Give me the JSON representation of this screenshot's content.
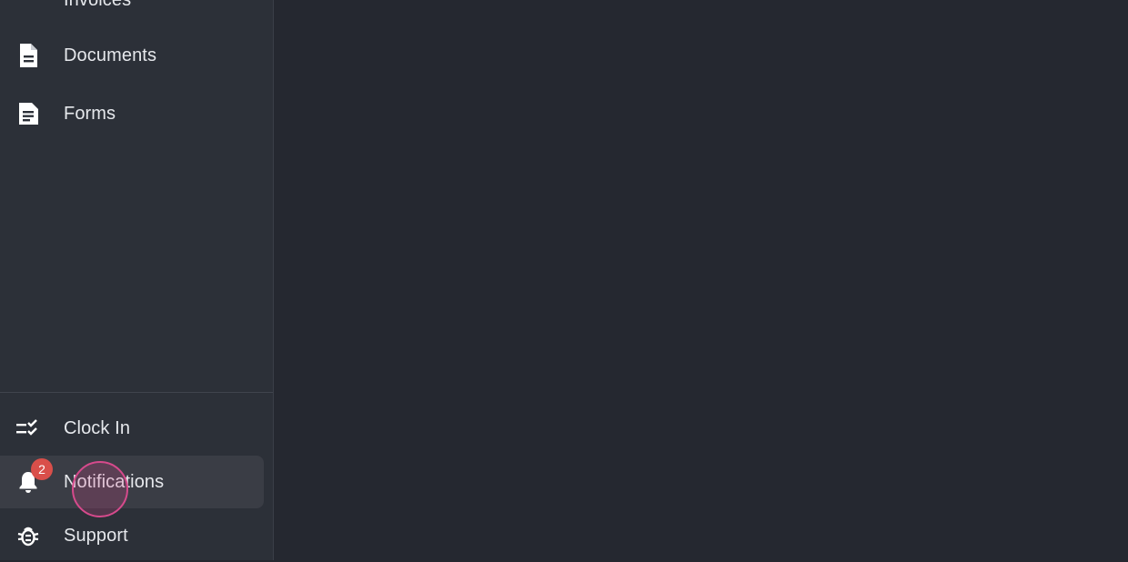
{
  "sidebar": {
    "top_items": [
      {
        "label": "Invoices",
        "icon": "receipt-icon"
      },
      {
        "label": "Documents",
        "icon": "document-icon"
      },
      {
        "label": "Forms",
        "icon": "form-icon"
      }
    ],
    "bottom_items": [
      {
        "label": "Clock In",
        "icon": "checklist-icon"
      },
      {
        "label": "Notifications",
        "icon": "bell-icon",
        "badge": "2",
        "active": true
      },
      {
        "label": "Support",
        "icon": "bug-icon"
      }
    ]
  },
  "colors": {
    "sidebar_bg": "#2c3038",
    "main_bg": "#252830",
    "active_item_bg": "#3a3d45",
    "badge": "#d94f4a",
    "click_indicator": "#d64a8c"
  }
}
